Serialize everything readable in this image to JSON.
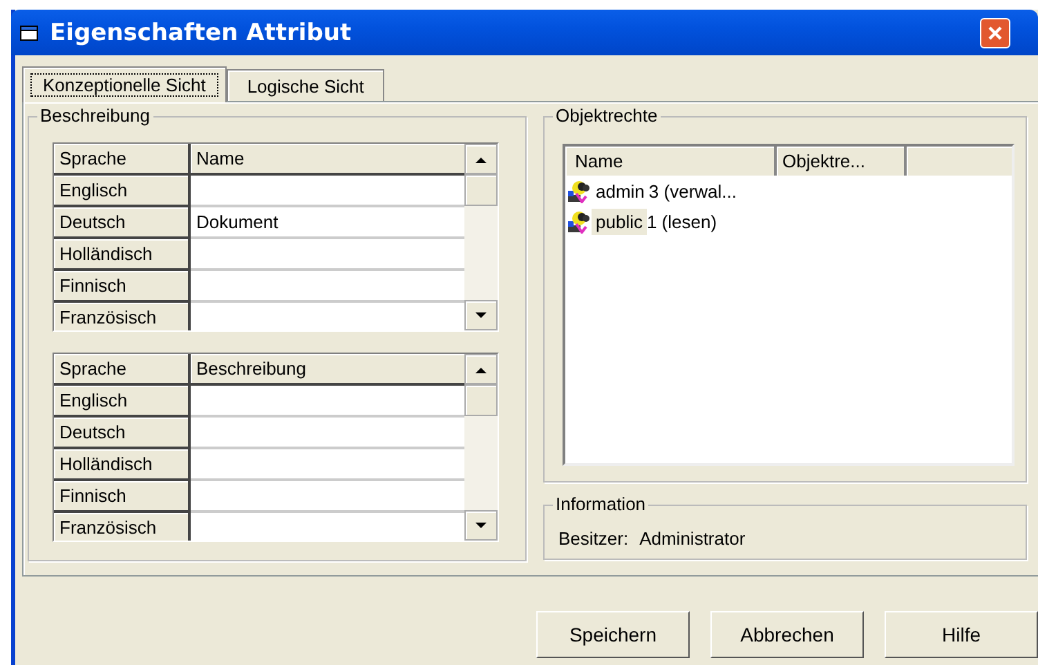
{
  "window": {
    "title": "Eigenschaften Attribut"
  },
  "tabs": [
    {
      "label": "Konzeptionelle Sicht",
      "selected": true
    },
    {
      "label": "Logische Sicht",
      "selected": false
    }
  ],
  "beschreibung": {
    "title": "Beschreibung",
    "grids": [
      {
        "columns": [
          "Sprache",
          "Name"
        ],
        "rows": [
          [
            "Englisch",
            ""
          ],
          [
            "Deutsch",
            "Dokument"
          ],
          [
            "Holländisch",
            ""
          ],
          [
            "Finnisch",
            ""
          ],
          [
            "Französisch",
            ""
          ]
        ]
      },
      {
        "columns": [
          "Sprache",
          "Beschreibung"
        ],
        "rows": [
          [
            "Englisch",
            ""
          ],
          [
            "Deutsch",
            ""
          ],
          [
            "Holländisch",
            ""
          ],
          [
            "Finnisch",
            ""
          ],
          [
            "Französisch",
            ""
          ]
        ]
      }
    ]
  },
  "objektrechte": {
    "title": "Objektrechte",
    "columns": [
      "Name",
      "Objektre..."
    ],
    "rows": [
      {
        "name": "admin",
        "right": "3 (verwal...",
        "selected": false
      },
      {
        "name": "public",
        "right": "1 (lesen)",
        "selected": true
      }
    ]
  },
  "information": {
    "title": "Information",
    "label": "Besitzer:",
    "value": "Administrator"
  },
  "buttons": [
    "Speichern",
    "Abbrechen",
    "Hilfe"
  ]
}
